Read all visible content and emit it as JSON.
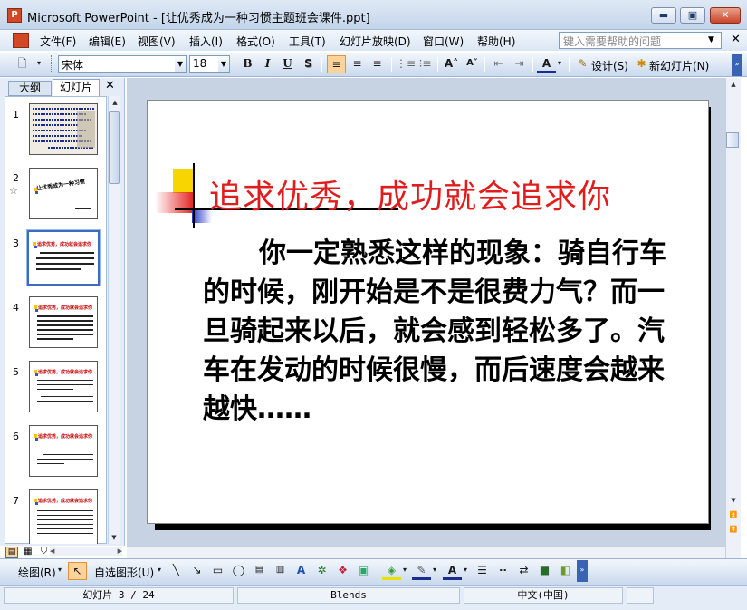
{
  "window": {
    "title": "Microsoft PowerPoint - [让优秀成为一种习惯主题班会课件.ppt]",
    "app_icon": "powerpoint-icon",
    "min_label": "▬",
    "max_label": "▣",
    "close_label": "✕"
  },
  "menubar": {
    "items": [
      "文件(F)",
      "编辑(E)",
      "视图(V)",
      "插入(I)",
      "格式(O)",
      "工具(T)",
      "幻灯片放映(D)",
      "窗口(W)",
      "帮助(H)"
    ],
    "help_placeholder": "键入需要帮助的问题",
    "close_label": "✕"
  },
  "toolbar": {
    "font_name": "宋体",
    "font_size": "18",
    "bold": "B",
    "italic": "I",
    "underline": "U",
    "shadow": "S",
    "design_label": "设计(S)",
    "new_slide_label": "新幻灯片(N)"
  },
  "leftpanel": {
    "tab_outline": "大纲",
    "tab_slides": "幻灯片",
    "close_label": "✕",
    "slide_numbers": [
      "1",
      "2",
      "3",
      "4",
      "5",
      "6",
      "7"
    ],
    "thumb2_title": "让优秀成为一种习惯",
    "thumb_title": "追求优秀，成功就会追求你"
  },
  "slide": {
    "title": "追求优秀，成功就会追求你",
    "body": "你一定熟悉这样的现象：骑自行车的时候，刚开始是不是很费力气？而一旦骑起来以后，就会感到轻松多了。汽车在发动的时候很慢，而后速度会越来越快……"
  },
  "drawbar": {
    "draw_label": "绘图(R)",
    "autoshape_label": "自选图形(U)"
  },
  "statusbar": {
    "slide_position": "幻灯片 3 / 24",
    "design_name": "Blends",
    "language": "中文(中国)"
  },
  "colors": {
    "title_red": "#e01c1c",
    "accent_yellow": "#f8d500",
    "accent_blue": "#2436c9"
  }
}
